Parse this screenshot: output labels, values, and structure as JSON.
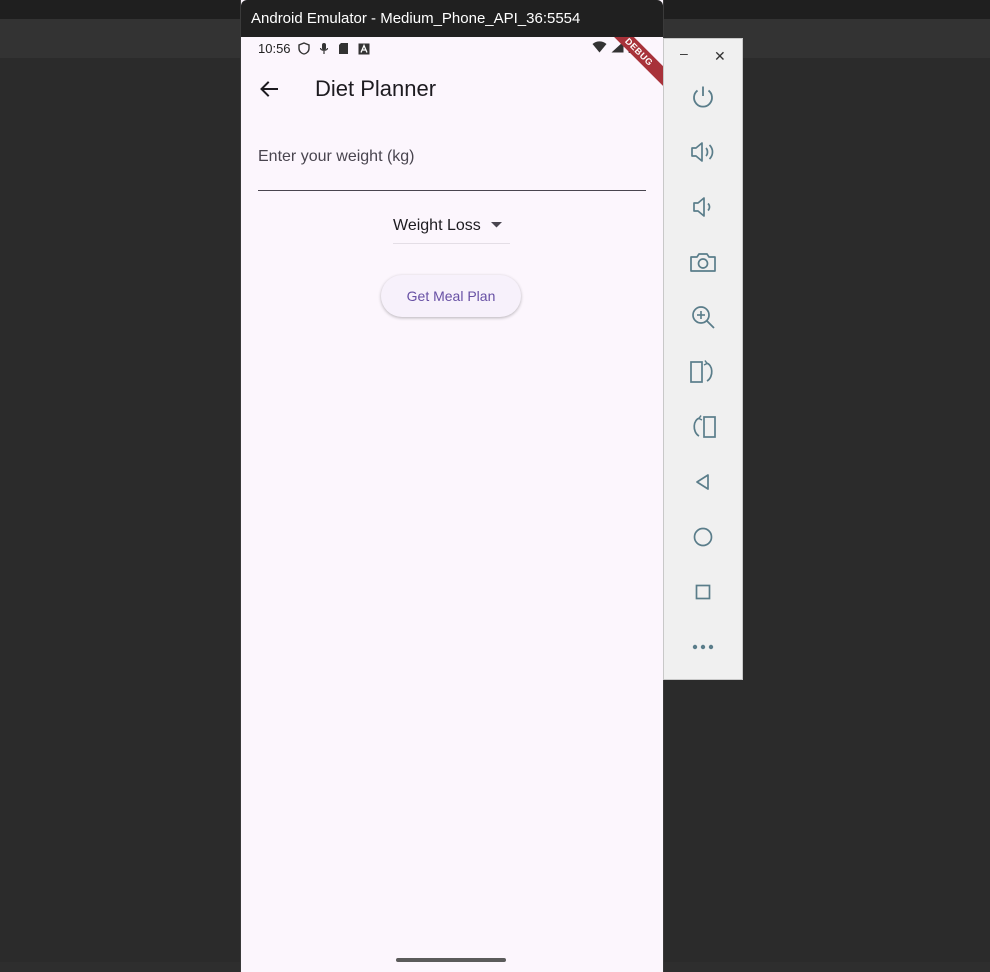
{
  "emulator": {
    "window_title": "Android Emulator - Medium_Phone_API_36:5554",
    "debug_label": "DEBUG"
  },
  "status_bar": {
    "time": "10:56"
  },
  "app_bar": {
    "title": "Diet Planner",
    "back_icon": "arrow-back-icon"
  },
  "form": {
    "weight_placeholder": "Enter your weight (kg)",
    "weight_value": "",
    "goal_selected": "Weight Loss",
    "submit_label": "Get Meal Plan"
  },
  "toolbar": {
    "minimize_label": "–",
    "close_label": "✕",
    "items": [
      "power-icon",
      "volume-up-icon",
      "volume-down-icon",
      "camera-icon",
      "zoom-in-icon",
      "rotate-right-icon",
      "rotate-left-icon",
      "back-triangle-icon",
      "home-circle-icon",
      "overview-square-icon",
      "more-icon"
    ]
  },
  "colors": {
    "phone_background": "#fcf6fd",
    "accent": "#6750a4",
    "debug_banner": "#a8323a"
  }
}
